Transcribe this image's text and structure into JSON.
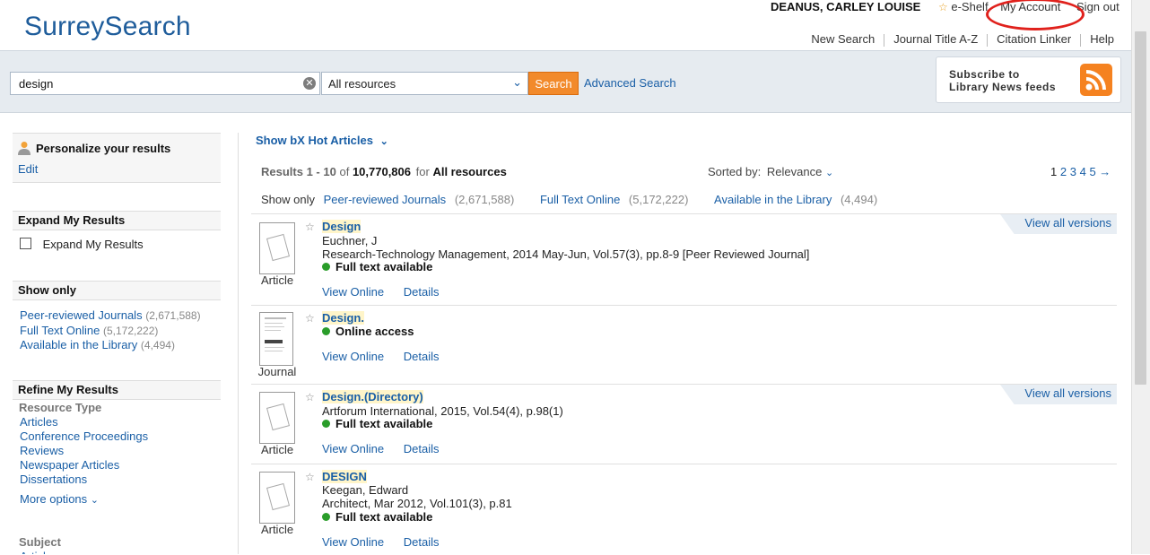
{
  "header": {
    "logo": "SurreySearch",
    "user_name": "DEANUS, CARLEY LOUISE",
    "eshelf": "e-Shelf",
    "my_account": "My Account",
    "sign_out": "Sign out",
    "nav": [
      "New Search",
      "Journal Title A-Z",
      "Citation Linker",
      "Help"
    ]
  },
  "search": {
    "query": "design",
    "scope": "All resources",
    "button": "Search",
    "advanced": "Advanced Search",
    "rss_line1": "Subscribe to",
    "rss_line2": "Library News feeds"
  },
  "sidebar": {
    "personalize_title": "Personalize your results",
    "edit": "Edit",
    "expand_title": "Expand My Results",
    "expand_checkbox": "Expand My Results",
    "showonly_title": "Show only",
    "showonly_items": [
      {
        "label": "Peer-reviewed Journals",
        "count": "(2,671,588)"
      },
      {
        "label": "Full Text Online",
        "count": "(5,172,222)"
      },
      {
        "label": "Available in the Library",
        "count": "(4,494)"
      }
    ],
    "refine_title": "Refine My Results",
    "resource_type": "Resource Type",
    "resource_items": [
      "Articles",
      "Conference Proceedings",
      "Reviews",
      "Newspaper Articles",
      "Dissertations"
    ],
    "more_options": "More options",
    "subject": "Subject",
    "subject_first": "Article"
  },
  "results": {
    "hot_articles": "Show bX Hot Articles",
    "results_prefix": "Results",
    "range": "1 - 10",
    "of": "of",
    "total": "10,770,806",
    "for": "for",
    "scope": "All resources",
    "sorted_by": "Sorted by:",
    "sort_value": "Relevance",
    "pages": [
      "1",
      "2",
      "3",
      "4",
      "5"
    ],
    "show_only": "Show only",
    "filters": [
      {
        "label": "Peer-reviewed Journals",
        "count": "(2,671,588)"
      },
      {
        "label": "Full Text Online",
        "count": "(5,172,222)"
      },
      {
        "label": "Available in the Library",
        "count": "(4,494)"
      }
    ],
    "items": [
      {
        "type": "Article",
        "title": "Design",
        "line1": "Euchner, J",
        "line2": "Research-Technology Management, 2014 May-Jun, Vol.57(3), pp.8-9 [Peer Reviewed Journal]",
        "availability": "Full text available",
        "view_online": "View Online",
        "details": "Details",
        "view_all": "View all versions"
      },
      {
        "type": "Journal",
        "title": "Design.",
        "line1": "",
        "line2": "",
        "availability": "Online access",
        "view_online": "View Online",
        "details": "Details",
        "view_all": ""
      },
      {
        "type": "Article",
        "title": "Design.(Directory)",
        "line1": "Artforum International, 2015, Vol.54(4), p.98(1)",
        "line2": "",
        "availability": "Full text available",
        "view_online": "View Online",
        "details": "Details",
        "view_all": "View all versions"
      },
      {
        "type": "Article",
        "title": "DESIGN",
        "line1": "Keegan, Edward",
        "line2": "Architect, Mar 2012, Vol.101(3), p.81",
        "availability": "Full text available",
        "view_online": "View Online",
        "details": "Details",
        "view_all": ""
      }
    ]
  },
  "colors": {
    "brand": "#1f5d9b",
    "link": "#1a5fa6",
    "search_button": "#f28a2b",
    "rss": "#f58220",
    "available": "#2a9d2a",
    "annotation": "#e0211c"
  }
}
